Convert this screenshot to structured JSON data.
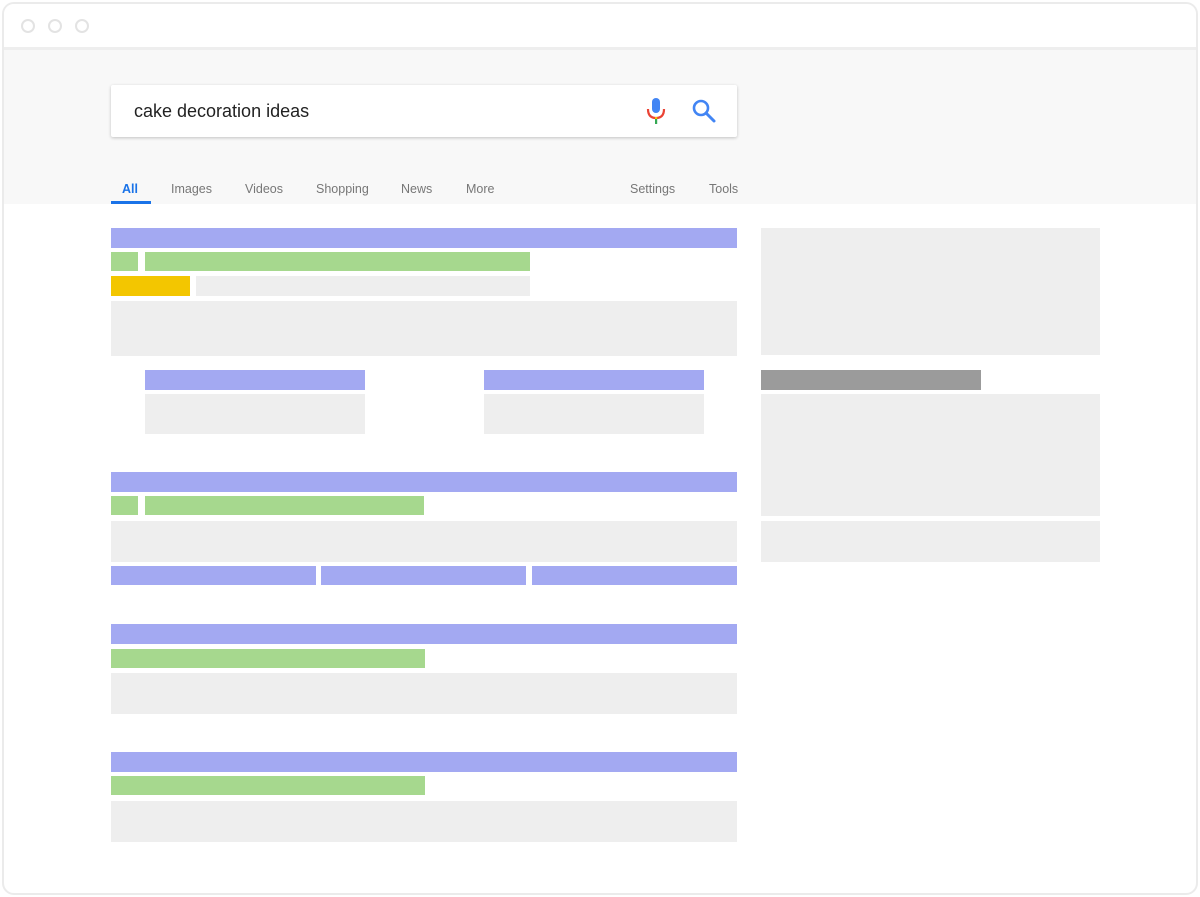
{
  "search": {
    "query": "cake decoration ideas"
  },
  "icons": {
    "mic": "microphone-icon",
    "search": "search-icon"
  },
  "tabs": [
    {
      "label": "All",
      "active": true
    },
    {
      "label": "Images"
    },
    {
      "label": "Videos"
    },
    {
      "label": "Shopping"
    },
    {
      "label": "News"
    },
    {
      "label": "More"
    }
  ],
  "tools": {
    "settings": "Settings",
    "tools": "Tools"
  },
  "colors": {
    "accent": "#1a73e8",
    "title_placeholder": "#a3a9f2",
    "url_placeholder": "#a6d88e",
    "ad_badge": "#f3c600",
    "text_placeholder": "#eeeeee"
  }
}
